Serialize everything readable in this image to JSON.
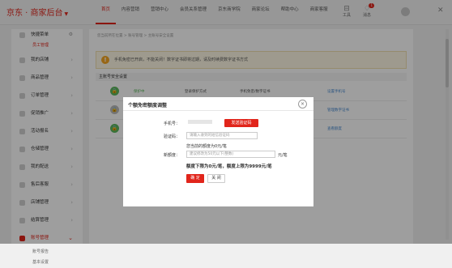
{
  "app": {
    "logo": "京东 · 商家后台",
    "logo_caret": "▼"
  },
  "nav": {
    "items": [
      "首页",
      "内容营销",
      "营销中心",
      "会员关系管理",
      "京东商学院",
      "商家论坛",
      "帮助中心",
      "商家客服"
    ]
  },
  "toolbar": {
    "tools_label": "工具",
    "messages_label": "消息",
    "messages_badge": "1"
  },
  "sidebar": {
    "items": [
      {
        "label": "快捷菜单"
      },
      {
        "sub": "员工管理"
      },
      {
        "label": "我的店铺"
      },
      {
        "label": "商品管理"
      },
      {
        "label": "订单管理"
      },
      {
        "label": "促销推广"
      },
      {
        "label": "活动报名"
      },
      {
        "label": "仓储管理"
      },
      {
        "label": "我的配送"
      },
      {
        "label": "售后客服"
      },
      {
        "label": "店铺管理"
      },
      {
        "label": "结算管理"
      },
      {
        "label": "账号管理"
      },
      {
        "sub": "账号报告"
      },
      {
        "sub": "基本设置"
      }
    ]
  },
  "content": {
    "breadcrumb": "您当前所在位置 > 账号管理 > 主账号安全设置",
    "warning": "手机免密已开启，不能关闭！数字证书即将过期，请及时续费数字证书方式",
    "section_title": "主账号安全设置",
    "rows": [
      {
        "status": "保护中",
        "label": "登录保护方式",
        "desc": "手机免密/数字证书",
        "link": "设置手机号"
      },
      {
        "status": "",
        "label": "",
        "desc": "",
        "link": "管理数字证书"
      },
      {
        "status": "",
        "label": "",
        "desc": "",
        "link": "查看额度"
      }
    ]
  },
  "modal": {
    "title": "个额免密额度调整",
    "phone_label": "手机号：",
    "send_code_button": "发送验证码",
    "code_label": "验证码：",
    "code_placeholder": "请输入收到的短信验证码",
    "current_limit_text": "您当前的额度为0元/笔",
    "new_limit_label": "新额度：",
    "new_limit_placeholder": "建议修改为50元以下(整数)",
    "unit": "元/笔",
    "limit_note": "额度下限为0元/笔，额度上限为9999元/笔",
    "confirm_button": "确 定",
    "cancel_button": "关 闭"
  }
}
